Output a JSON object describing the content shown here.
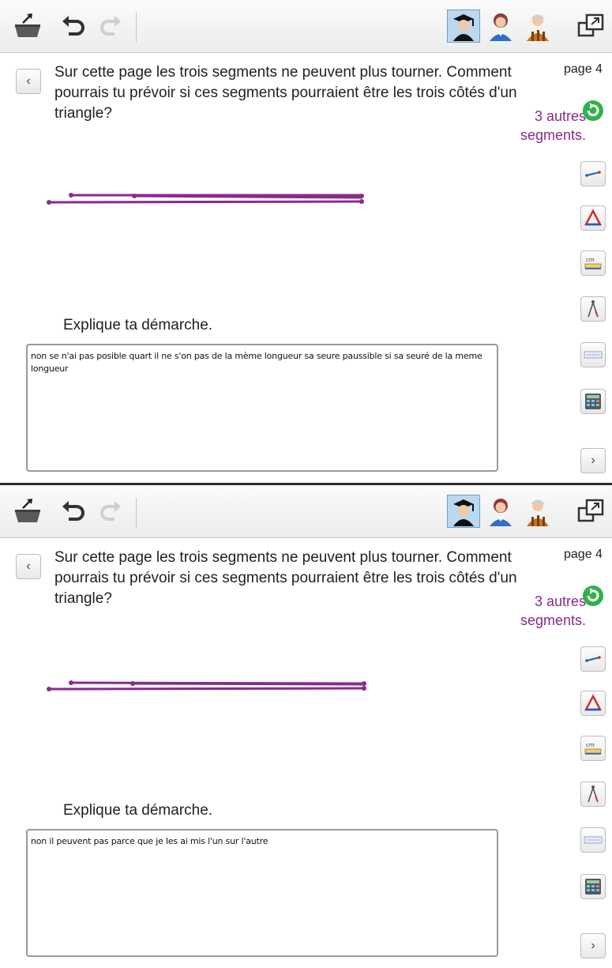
{
  "colors": {
    "segment": "#8a2a8c",
    "toolbar_selected": "#bcd8f0",
    "accent_text": "#8a2a8c"
  },
  "toolbar": {
    "icons": [
      "export-icon",
      "undo-icon",
      "redo-icon",
      "student-icon",
      "teacher-icon",
      "elder-icon",
      "window-icon"
    ],
    "selected": "student-icon"
  },
  "question": "Sur cette page les trois segments ne peuvent plus tourner. Comment pourrais tu prévoir si ces segments pourraient être les trois côtés d'un triangle?",
  "page_label": "page 4",
  "other_segments": "3 autres segments.",
  "tools": [
    "segment-tool-icon",
    "triangle-tool-icon",
    "ruler-cm-icon",
    "compass-icon",
    "keyboard-icon",
    "calculator-icon"
  ],
  "explain_prompt": "Explique ta démarche.",
  "panels": [
    {
      "answer": "non se n'ai pas posible quart il ne s'on pas de la mème longueur sa seure paussible si sa seuré de la meme longueur"
    },
    {
      "answer": "non il peuvent pas parce que je les ai mis l'un sur l'autre"
    }
  ]
}
